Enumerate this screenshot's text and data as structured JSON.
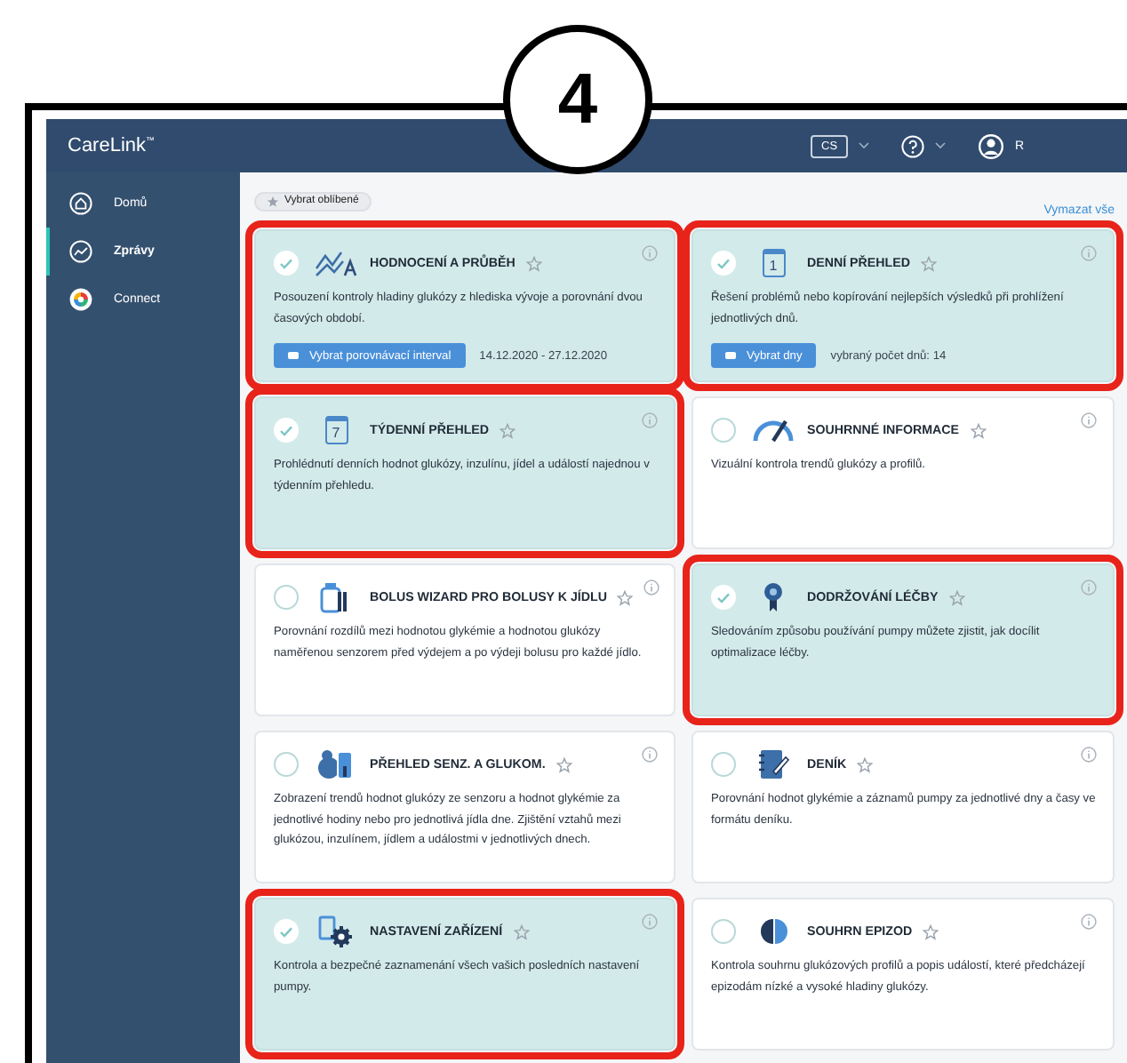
{
  "callout": {
    "number": "4"
  },
  "header": {
    "logo": "CareLink",
    "logo_mark": "™",
    "language": "CS",
    "user_initial": "R"
  },
  "sidebar": {
    "items": [
      {
        "label": "Domů",
        "kind": "home",
        "selected": false
      },
      {
        "label": "Zprávy",
        "kind": "chart",
        "selected": true
      },
      {
        "label": "Connect",
        "kind": "connect",
        "selected": false
      }
    ]
  },
  "toolbar": {
    "favorites_button": "Vybrat oblíbené",
    "clear_link": "Vymazat vše"
  },
  "reports": [
    {
      "kind": "trend",
      "title": "HODNOCENÍ A PRŮBĚH",
      "description": "Posouzení kontroly hladiny glukózy z hlediska vývoje a porovnání dvou časových období.",
      "selected": true,
      "highlighted": true,
      "action": {
        "button": "Vybrat porovnávací interval",
        "note": "14.12.2020 - 27.12.2020"
      }
    },
    {
      "kind": "calendar",
      "icon_label": "1",
      "title": "DENNÍ PŘEHLED",
      "description": "Řešení problémů nebo kopírování nejlepších výsledků při prohlížení jednotlivých dnů.",
      "selected": true,
      "highlighted": true,
      "action": {
        "button": "Vybrat dny",
        "note": "vybraný počet dnů: 14"
      }
    },
    {
      "kind": "calendar",
      "icon_label": "7",
      "title": "TÝDENNÍ PŘEHLED",
      "description": "Prohlédnutí denních hodnot glukózy, inzulínu, jídel a událostí najednou v týdenním přehledu.",
      "selected": true,
      "highlighted": true
    },
    {
      "kind": "gauge",
      "title": "SOUHRNNÉ INFORMACE",
      "description": "Vizuální kontrola trendů glukózy a profilů.",
      "selected": false,
      "highlighted": false
    },
    {
      "kind": "bolus",
      "title": "BOLUS WIZARD PRO BOLUSY K JÍDLU",
      "description": "Porovnání rozdílů mezi hodnotou glykémie a hodnotou glukózy naměřenou senzorem před výdejem a po výdeji bolusu pro každé jídlo.",
      "selected": false,
      "highlighted": false
    },
    {
      "kind": "ribbon",
      "title": "DODRŽOVÁNÍ LÉČBY",
      "description": "Sledováním způsobu používání pumpy můžete zjistit, jak docílit optimalizace léčby.",
      "selected": true,
      "highlighted": true
    },
    {
      "kind": "sensor",
      "title": "PŘEHLED SENZ. A GLUKOM.",
      "description": "Zobrazení trendů hodnot glukózy ze senzoru a hodnot glykémie za jednotlivé hodiny nebo pro jednotlivá jídla dne. Zjištění vztahů mezi glukózou, inzulínem, jídlem a událostmi v jednotlivých dnech.",
      "selected": false,
      "highlighted": false
    },
    {
      "kind": "diary",
      "title": "DENÍK",
      "description": "Porovnání hodnot glykémie a záznamů pumpy za jednotlivé dny a časy ve formátu deníku.",
      "selected": false,
      "highlighted": false
    },
    {
      "kind": "settings",
      "title": "NASTAVENÍ ZAŘÍZENÍ",
      "description": "Kontrola a bezpečné zaznamenání všech vašich posledních nastavení pumpy.",
      "selected": true,
      "highlighted": true
    },
    {
      "kind": "halfcircle",
      "title": "SOUHRN EPIZOD",
      "description": "Kontrola souhrnu glukózových profilů a popis událostí, které předcházejí epizodám nízké a vysoké hladiny glukózy.",
      "selected": false,
      "highlighted": false
    }
  ]
}
